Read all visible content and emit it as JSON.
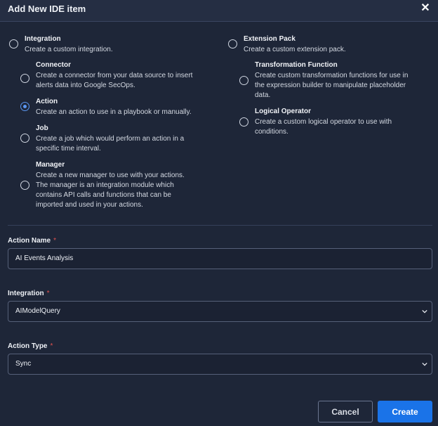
{
  "dialog": {
    "title": "Add New IDE item",
    "close_symbol": "✕"
  },
  "types": {
    "integration": {
      "title": "Integration",
      "desc": [
        "Create a custom integration."
      ],
      "selected": false
    },
    "connector": {
      "title": "Connector",
      "desc": [
        "Create a connector from your data source to insert",
        "alerts data into Google SecOps."
      ],
      "selected": false
    },
    "action": {
      "title": "Action",
      "desc": [
        "Create an action to use in a playbook or manually."
      ],
      "selected": true
    },
    "job": {
      "title": "Job",
      "desc": [
        "Create a job which would perform an action in a",
        "specific time interval."
      ],
      "selected": false
    },
    "manager": {
      "title": "Manager",
      "desc": [
        "Create a new manager to use with your actions.",
        "The manager is an integration module which",
        "contains API calls and functions that can be",
        "imported and used in your actions."
      ],
      "selected": false
    },
    "extension_pack": {
      "title": "Extension Pack",
      "desc": [
        "Create a custom extension pack."
      ],
      "selected": false
    },
    "transformation_function": {
      "title": "Transformation Function",
      "desc": [
        "Create custom transformation functions for use in",
        "the expression builder to manipulate placeholder",
        "data."
      ],
      "selected": false
    },
    "logical_operator": {
      "title": "Logical Operator",
      "desc": [
        "Create a custom logical operator to use with",
        "conditions."
      ],
      "selected": false
    }
  },
  "form": {
    "action_name": {
      "label": "Action Name",
      "required_mark": "*",
      "value": "AI Events Analysis"
    },
    "integration": {
      "label": "Integration",
      "required_mark": "*",
      "value": "AIModelQuery"
    },
    "action_type": {
      "label": "Action Type",
      "required_mark": "*",
      "value": "Sync"
    }
  },
  "buttons": {
    "cancel": "Cancel",
    "create": "Create"
  },
  "colors": {
    "background": "#1e2638",
    "accent": "#1a73e8",
    "selected_radio": "#5b97f2",
    "required": "#e0524f"
  },
  "icons": {
    "close": "close-icon",
    "dropdown": "chevron-down-icon"
  }
}
